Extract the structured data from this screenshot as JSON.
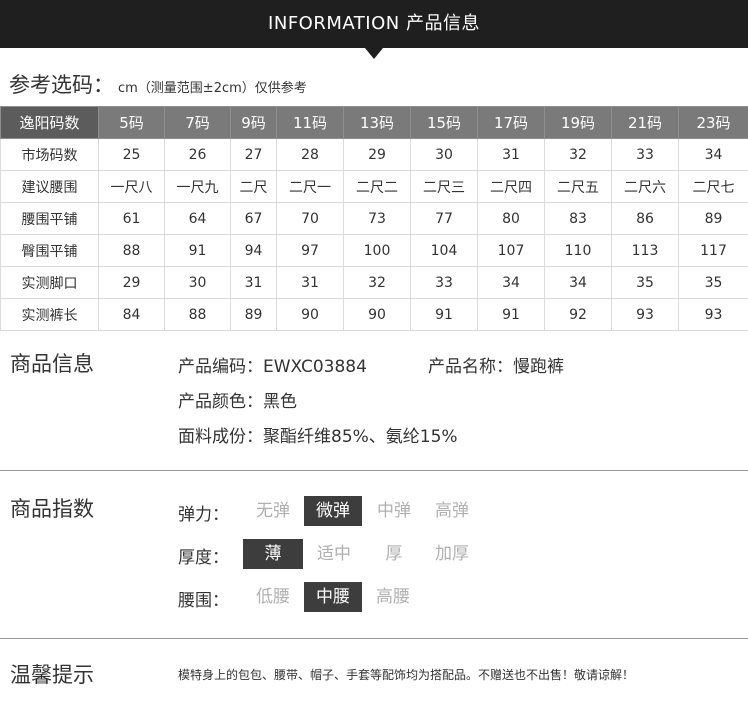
{
  "banner": {
    "title": "INFORMATION 产品信息"
  },
  "size_section": {
    "heading": "参考选码：",
    "note": "cm（测量范围±2cm）仅供参考",
    "columns": [
      "逸阳码数",
      "5码",
      "7码",
      "9码",
      "11码",
      "13码",
      "15码",
      "17码",
      "19码",
      "21码",
      "23码"
    ],
    "rows": [
      [
        "市场码数",
        "25",
        "26",
        "27",
        "28",
        "29",
        "30",
        "31",
        "32",
        "33",
        "34"
      ],
      [
        "建议腰围",
        "一尺八",
        "一尺九",
        "二尺",
        "二尺一",
        "二尺二",
        "二尺三",
        "二尺四",
        "二尺五",
        "二尺六",
        "二尺七"
      ],
      [
        "腰围平铺",
        "61",
        "64",
        "67",
        "70",
        "73",
        "77",
        "80",
        "83",
        "86",
        "89"
      ],
      [
        "臀围平铺",
        "88",
        "91",
        "94",
        "97",
        "100",
        "104",
        "107",
        "110",
        "113",
        "117"
      ],
      [
        "实测脚口",
        "29",
        "30",
        "31",
        "31",
        "32",
        "33",
        "34",
        "34",
        "35",
        "35"
      ],
      [
        "实测裤长",
        "84",
        "88",
        "89",
        "90",
        "90",
        "91",
        "91",
        "92",
        "93",
        "93"
      ]
    ]
  },
  "product_info": {
    "title": "商品信息",
    "code": "产品编码：EWXC03884",
    "name": "产品名称：慢跑裤",
    "color": "产品颜色：黑色",
    "fabric": "面料成份：聚酯纤维85%、氨纶15%"
  },
  "product_index": {
    "title": "商品指数",
    "elasticity": {
      "label": "弹力：",
      "options": [
        "无弹",
        "微弹",
        "中弹",
        "高弹"
      ],
      "selected": "微弹"
    },
    "thickness": {
      "label": "厚度：",
      "options": [
        "薄",
        "适中",
        "厚",
        "加厚"
      ],
      "selected": "薄"
    },
    "waist": {
      "label": "腰围：",
      "options": [
        "低腰",
        "中腰",
        "高腰"
      ],
      "selected": "中腰"
    }
  },
  "tips": {
    "title": "温馨提示",
    "text": "模特身上的包包、腰带、帽子、手套等配饰均为搭配品。不赠送也不出售！敬请谅解！"
  },
  "colors": {
    "banner": "#1f1f1f",
    "header": "#7a7a7a",
    "selected": "#3d3d3d",
    "unselected": "#b0b0b0"
  }
}
